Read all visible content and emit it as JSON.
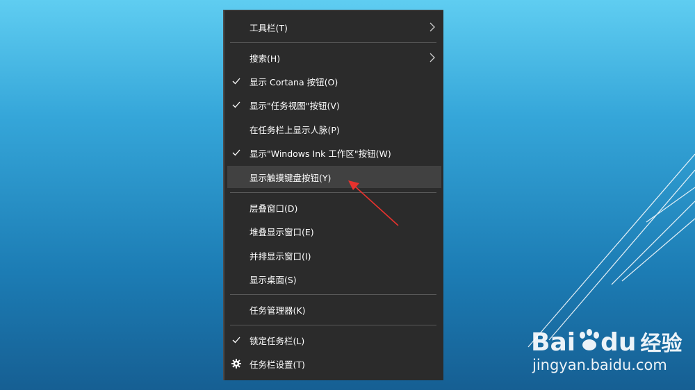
{
  "menu": {
    "items": [
      {
        "label": "工具栏(T)",
        "checked": false,
        "submenu": true
      },
      {
        "label": "搜索(H)",
        "checked": false,
        "submenu": true
      },
      {
        "label": "显示 Cortana 按钮(O)",
        "checked": true,
        "submenu": false
      },
      {
        "label": "显示\"任务视图\"按钮(V)",
        "checked": true,
        "submenu": false
      },
      {
        "label": "在任务栏上显示人脉(P)",
        "checked": false,
        "submenu": false
      },
      {
        "label": "显示\"Windows Ink 工作区\"按钮(W)",
        "checked": true,
        "submenu": false
      },
      {
        "label": "显示触摸键盘按钮(Y)",
        "checked": false,
        "submenu": false,
        "highlighted": true
      },
      {
        "label": "层叠窗口(D)",
        "checked": false,
        "submenu": false
      },
      {
        "label": "堆叠显示窗口(E)",
        "checked": false,
        "submenu": false
      },
      {
        "label": "并排显示窗口(I)",
        "checked": false,
        "submenu": false
      },
      {
        "label": "显示桌面(S)",
        "checked": false,
        "submenu": false
      },
      {
        "label": "任务管理器(K)",
        "checked": false,
        "submenu": false
      },
      {
        "label": "锁定任务栏(L)",
        "checked": true,
        "submenu": false
      },
      {
        "label": "任务栏设置(T)",
        "checked": false,
        "submenu": false,
        "icon": "gear-icon"
      }
    ]
  },
  "watermark": {
    "logo_text": "Bai",
    "logo_text2": "du",
    "logo_cn": "经验",
    "url": "jingyan.baidu.com"
  },
  "colors": {
    "menu_bg": "#2b2b2b",
    "highlight_bg": "#414141",
    "annotation_arrow": "#e8322d"
  }
}
